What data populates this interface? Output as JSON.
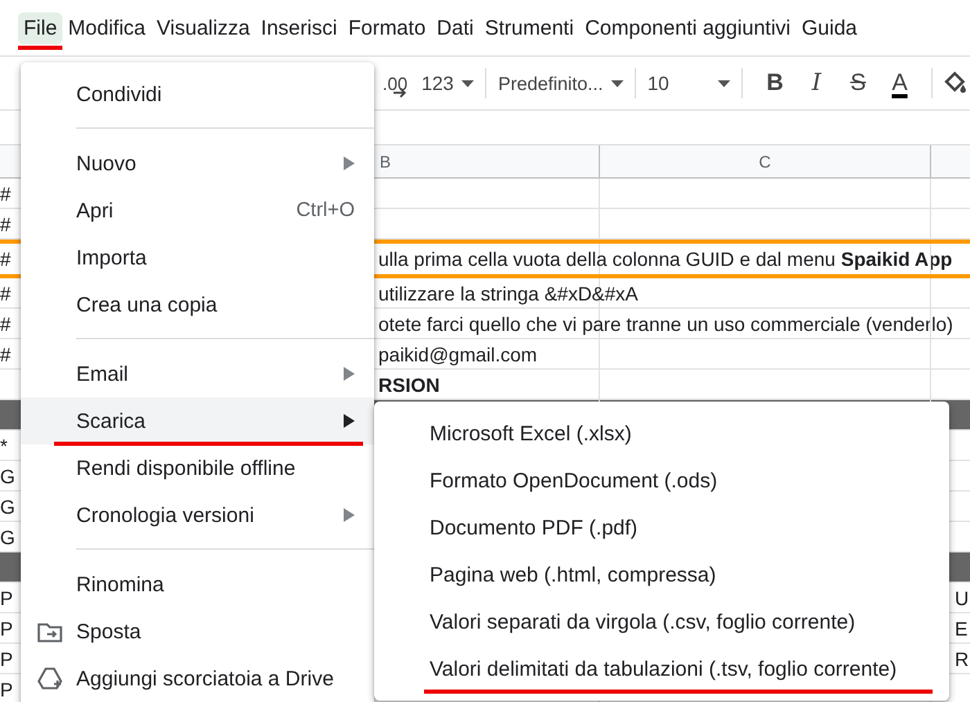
{
  "menubar": [
    {
      "label": "File",
      "selected": true,
      "underlined": true
    },
    {
      "label": "Modifica",
      "selected": false,
      "underlined": false
    },
    {
      "label": "Visualizza",
      "selected": false,
      "underlined": false
    },
    {
      "label": "Inserisci",
      "selected": false,
      "underlined": false
    },
    {
      "label": "Formato",
      "selected": false,
      "underlined": false
    },
    {
      "label": "Dati",
      "selected": false,
      "underlined": false
    },
    {
      "label": "Strumenti",
      "selected": false,
      "underlined": false
    },
    {
      "label": "Componenti aggiuntivi",
      "selected": false,
      "underlined": false
    },
    {
      "label": "Guida",
      "selected": false,
      "underlined": false
    }
  ],
  "toolbar": {
    "decimal": ".00",
    "number_format": "123",
    "font": "Predefinito...",
    "font_size": "10",
    "format_buttons": [
      {
        "kind": "bold",
        "label": "B"
      },
      {
        "kind": "italic",
        "label": "I"
      },
      {
        "kind": "strike",
        "label": "S"
      },
      {
        "kind": "color",
        "label": "A"
      }
    ]
  },
  "columns": [
    "B",
    "C"
  ],
  "rows": [
    {
      "kind": "normal",
      "a": "#"
    },
    {
      "kind": "normal",
      "a": "#"
    },
    {
      "kind": "highlight",
      "a": "#",
      "b": "ulla prima cella vuota della colonna GUID e dal menu **Spaikid App**"
    },
    {
      "kind": "normal",
      "a": "#",
      "b": "utilizzare la stringa  &#xD&#xA"
    },
    {
      "kind": "normal",
      "a": "#",
      "b": "otete farci quello che vi pare tranne un uso commerciale (venderlo)"
    },
    {
      "kind": "normal",
      "a": "#",
      "b": "paikid@gmail.com"
    },
    {
      "kind": "normal",
      "b": "**RSION**"
    },
    {
      "kind": "dark"
    },
    {
      "kind": "normal",
      "a": "*"
    },
    {
      "kind": "normal",
      "a": "G"
    },
    {
      "kind": "normal",
      "a": "G"
    },
    {
      "kind": "normal",
      "a": "G"
    },
    {
      "kind": "dark"
    },
    {
      "kind": "normal",
      "a": "P",
      "d": "U"
    },
    {
      "kind": "normal",
      "a": "P",
      "d": "E"
    },
    {
      "kind": "normal",
      "a": "P",
      "d": "R"
    },
    {
      "kind": "normal",
      "a": "P"
    }
  ],
  "file_menu": [
    {
      "kind": "item",
      "label": "Condividi",
      "submenu": false,
      "highlighted": false,
      "underlined": false
    },
    {
      "kind": "divider"
    },
    {
      "kind": "item",
      "label": "Nuovo",
      "submenu": true,
      "highlighted": false,
      "underlined": false
    },
    {
      "kind": "item",
      "label": "Apri",
      "shortcut": "Ctrl+O",
      "submenu": false,
      "highlighted": false,
      "underlined": false
    },
    {
      "kind": "item",
      "label": "Importa",
      "submenu": false,
      "highlighted": false,
      "underlined": false
    },
    {
      "kind": "item",
      "label": "Crea una copia",
      "submenu": false,
      "highlighted": false,
      "underlined": false
    },
    {
      "kind": "divider"
    },
    {
      "kind": "item",
      "label": "Email",
      "submenu": true,
      "highlighted": false,
      "underlined": false
    },
    {
      "kind": "item",
      "label": "Scarica",
      "submenu": true,
      "highlighted": true,
      "underlined": true
    },
    {
      "kind": "item",
      "label": "Rendi disponibile offline",
      "submenu": false,
      "highlighted": false,
      "underlined": false
    },
    {
      "kind": "item",
      "label": "Cronologia versioni",
      "submenu": true,
      "highlighted": false,
      "underlined": false
    },
    {
      "kind": "divider"
    },
    {
      "kind": "item",
      "label": "Rinomina",
      "submenu": false,
      "highlighted": false,
      "underlined": false
    },
    {
      "kind": "icon_item",
      "label": "Sposta",
      "submenu": false,
      "highlighted": false,
      "underlined": false
    },
    {
      "kind": "icon_item",
      "label": "Aggiungi scorciatoia a Drive",
      "submenu": false,
      "highlighted": false,
      "underlined": false
    }
  ],
  "download_menu": [
    {
      "label": "Microsoft Excel (.xlsx)",
      "underlined": false
    },
    {
      "label": "Formato OpenDocument (.ods)",
      "underlined": false
    },
    {
      "label": "Documento PDF (.pdf)",
      "underlined": false
    },
    {
      "label": "Pagina web (.html, compressa)",
      "underlined": false
    },
    {
      "label": "Valori separati da virgola (.csv, foglio corrente)",
      "underlined": false
    },
    {
      "label": "Valori delimitati da tabulazioni (.tsv, foglio corrente)",
      "underlined": true
    }
  ]
}
